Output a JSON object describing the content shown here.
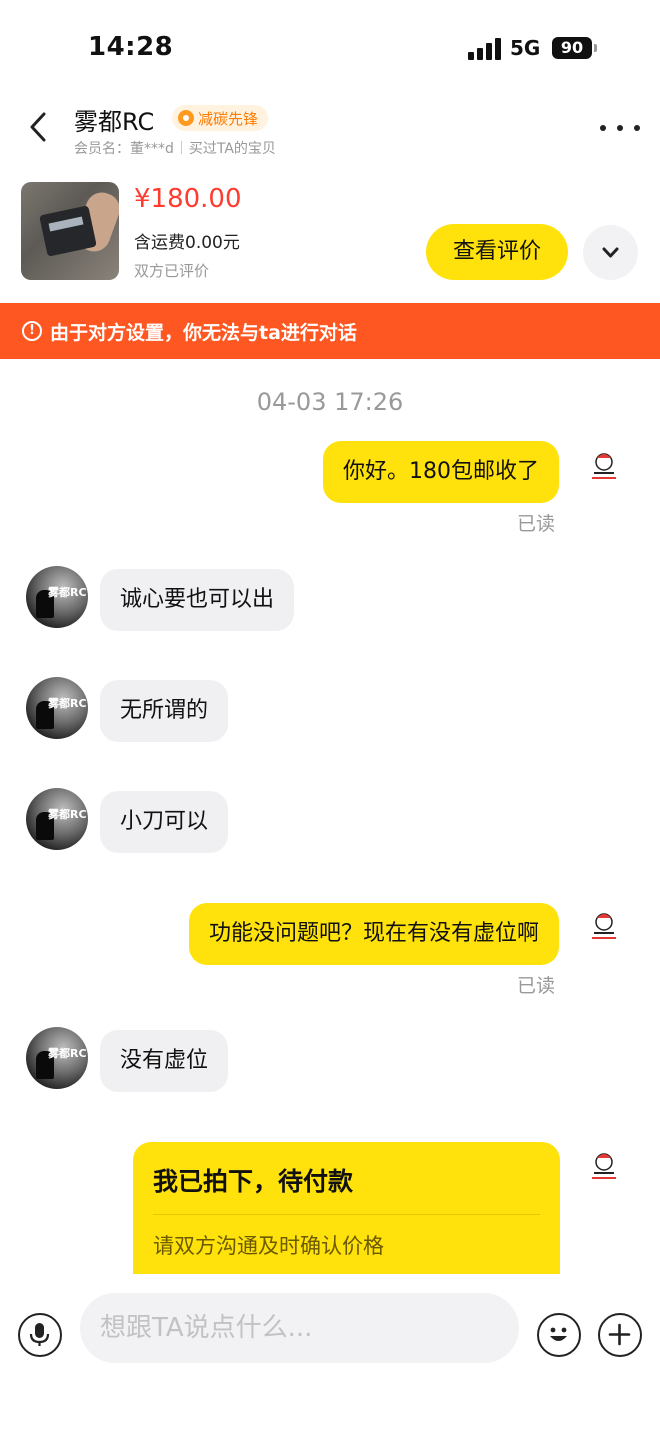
{
  "status_bar": {
    "time": "14:28",
    "network": "5G",
    "battery": "90"
  },
  "header": {
    "shop_name": "雾都RC",
    "badge": "减碳先锋",
    "member_label": "会员名：董***d",
    "purchase_note": "买过TA的宝贝",
    "back_icon": "chevron-left-icon",
    "more_icon": "more-dots-icon"
  },
  "product": {
    "price": "¥180.00",
    "shipping": "含运费0.00元",
    "evaluation_status": "双方已评价",
    "view_button": "查看评价",
    "expand_icon": "chevron-down-icon"
  },
  "warning": {
    "icon": "!",
    "text": "由于对方设置，你无法与ta进行对话"
  },
  "chat": {
    "timestamp": "04-03 17:26",
    "messages": [
      {
        "side": "out",
        "text": "你好。180包邮收了",
        "status": "已读"
      },
      {
        "side": "in",
        "text": "诚心要也可以出"
      },
      {
        "side": "in",
        "text": "无所谓的"
      },
      {
        "side": "in",
        "text": "小刀可以"
      },
      {
        "side": "out",
        "text": "功能没问题吧？现在有没有虚位啊",
        "status": "已读"
      },
      {
        "side": "in",
        "text": "没有虚位"
      }
    ],
    "peer_avatar_text": "雾都RC",
    "order_card": {
      "title": "我已拍下，待付款",
      "subtitle": "请双方沟通及时确认价格"
    }
  },
  "input_bar": {
    "placeholder": "想跟TA说点什么...",
    "mic_icon": "microphone-icon",
    "emoji_icon": "emoji-icon",
    "plus_icon": "plus-icon"
  },
  "colors": {
    "accent_yellow": "#ffe20b",
    "warning_orange": "#ff5722",
    "price_red": "#ff3b30"
  }
}
